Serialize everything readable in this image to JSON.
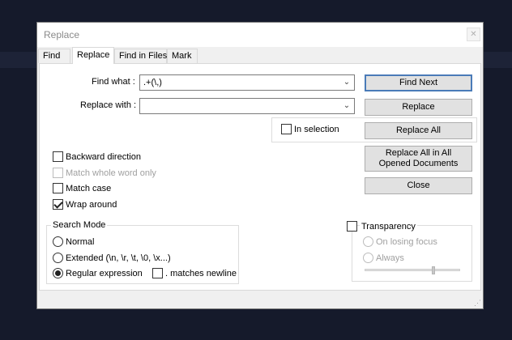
{
  "dialog": {
    "title": "Replace",
    "close_glyph": "✕"
  },
  "tabs": [
    {
      "label": "Find"
    },
    {
      "label": "Replace",
      "active": true
    },
    {
      "label": "Find in Files"
    },
    {
      "label": "Mark"
    }
  ],
  "find": {
    "label": "Find what :",
    "value": ".+(\\,)"
  },
  "replace": {
    "label": "Replace with :",
    "value": ""
  },
  "in_selection": {
    "label": "In selection",
    "checked": false
  },
  "buttons": {
    "find_next": "Find Next",
    "replace": "Replace",
    "replace_all": "Replace All",
    "replace_all_opened": "Replace All in All Opened Documents",
    "close": "Close"
  },
  "options": {
    "backward": {
      "label": "Backward direction",
      "checked": false
    },
    "whole_word": {
      "label": "Match whole word only",
      "checked": false,
      "enabled": false
    },
    "match_case": {
      "label": "Match case",
      "checked": false
    },
    "wrap_around": {
      "label": "Wrap around",
      "checked": true
    }
  },
  "search_mode": {
    "title": "Search Mode",
    "normal": "Normal",
    "extended": "Extended (\\n, \\r, \\t, \\0, \\x...)",
    "regex": "Regular expression",
    "selected": "regex",
    "matches_newline": {
      "label": ". matches newline",
      "checked": false
    }
  },
  "transparency": {
    "label": "Transparency",
    "checked": false,
    "on_losing_focus": "On losing focus",
    "always": "Always",
    "slider_level": 0.72
  }
}
